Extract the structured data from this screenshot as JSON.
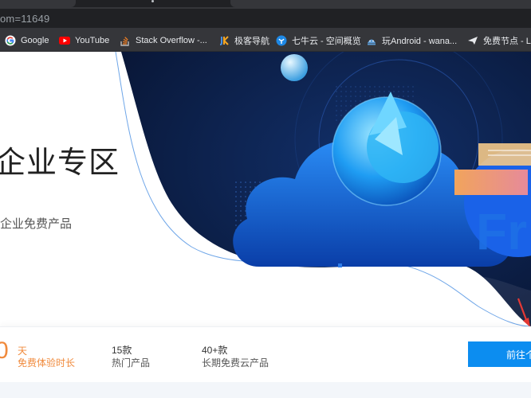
{
  "browser": {
    "url": "om=11649",
    "bookmarks": [
      {
        "label": "Google",
        "icon": "google-icon"
      },
      {
        "label": "YouTube",
        "icon": "youtube-icon"
      },
      {
        "label": "Stack Overflow -...",
        "icon": "stackoverflow-icon"
      },
      {
        "label": "极客导航",
        "icon": "jk-icon"
      },
      {
        "label": "七牛云 - 空间概览",
        "icon": "qiniu-icon"
      },
      {
        "label": "玩Android - wana...",
        "icon": "wanandroid-icon"
      },
      {
        "label": "免费节点 - Ln",
        "icon": "paper-plane-icon"
      }
    ]
  },
  "hero": {
    "title": "企业专区",
    "subtitle": "企业免费产品",
    "art_text": "Fr"
  },
  "stats": {
    "trial_number": "0",
    "trial_unit": "天",
    "trial_label": "免费体验时长",
    "hot_value": "15款",
    "hot_label": "热门产品",
    "free_value": "40+款",
    "free_label": "长期免费云产品",
    "cta_label": "前往个"
  },
  "colors": {
    "accent_orange": "#f08a3c",
    "cta_blue": "#0c8df0",
    "hero_navy": "#0b1a3a"
  }
}
